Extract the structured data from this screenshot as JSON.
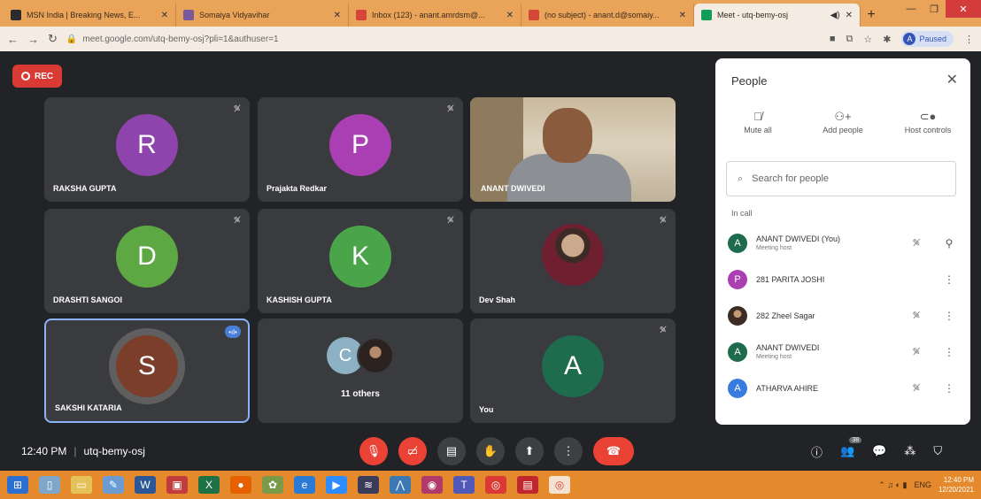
{
  "browser": {
    "tabs": [
      {
        "title": "MSN India | Breaking News, E...",
        "color": "#2b2b2b",
        "active": false
      },
      {
        "title": "Somaiya Vidyavihar",
        "color": "#7a5a9a",
        "active": false
      },
      {
        "title": "Inbox (123) - anant.amrdsm@...",
        "color": "#d44638",
        "active": false
      },
      {
        "title": "(no subject) - anant.d@somaiy...",
        "color": "#d44638",
        "active": false
      },
      {
        "title": "Meet - utq-bemy-osj",
        "color": "#0f9d58",
        "active": true
      }
    ],
    "url": "meet.google.com/utq-bemy-osj?pli=1&authuser=1",
    "profile_initial": "A",
    "profile_label": "Paused"
  },
  "meet": {
    "rec_label": "REC",
    "tiles": [
      {
        "name": "RAKSHA GUPTA",
        "initial": "R",
        "color": "#8e44ad",
        "type": "initial"
      },
      {
        "name": "Prajakta Redkar",
        "initial": "P",
        "color": "#a93fb3",
        "type": "initial"
      },
      {
        "name": "ANANT DWIVEDI",
        "initial": "",
        "color": "",
        "type": "video"
      },
      {
        "name": "DRASHTI SANGOI",
        "initial": "D",
        "color": "#5ea843",
        "type": "initial"
      },
      {
        "name": "KASHISH GUPTA",
        "initial": "K",
        "color": "#4aa54a",
        "type": "initial"
      },
      {
        "name": "Dev Shah",
        "initial": "",
        "color": "",
        "type": "avatar"
      },
      {
        "name": "SAKSHI KATARIA",
        "initial": "S",
        "color": "#7a3e2a",
        "type": "speaking"
      },
      {
        "name": "11 others",
        "initial": "C",
        "color": "#8db1c4",
        "type": "others"
      },
      {
        "name": "You",
        "initial": "A",
        "color": "#1e6b4e",
        "type": "initial"
      }
    ],
    "clock": "12:40 PM",
    "meeting_code": "utq-bemy-osj",
    "participant_count": "38"
  },
  "people_panel": {
    "title": "People",
    "actions": [
      {
        "label": "Mute all",
        "icon": "mic-off-icon"
      },
      {
        "label": "Add people",
        "icon": "add-person-icon"
      },
      {
        "label": "Host controls",
        "icon": "toggle-icon"
      }
    ],
    "search_placeholder": "Search for people",
    "section_label": "In call",
    "people": [
      {
        "name": "ANANT DWIVEDI (You)",
        "sub": "Meeting host",
        "initial": "A",
        "color": "#1e6b4e"
      },
      {
        "name": "281 PARITA JOSHI",
        "sub": "",
        "initial": "P",
        "color": "#a93fb3"
      },
      {
        "name": "282 Zheel Sagar",
        "sub": "",
        "initial": "",
        "color": ""
      },
      {
        "name": "ANANT DWIVEDI",
        "sub": "Meeting host",
        "initial": "A",
        "color": "#1e6b4e"
      },
      {
        "name": "ATHARVA AHIRE",
        "sub": "",
        "initial": "A",
        "color": "#3a7be0"
      }
    ]
  },
  "taskbar": {
    "lang": "ENG",
    "time": "12:40 PM",
    "date": "12/20/2021"
  }
}
